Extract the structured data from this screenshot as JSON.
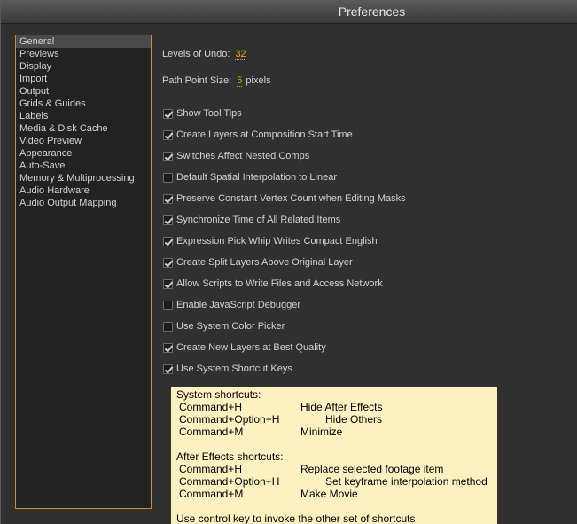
{
  "window": {
    "title": "Preferences"
  },
  "sidebar": {
    "items": [
      {
        "label": "General",
        "selected": true
      },
      {
        "label": "Previews"
      },
      {
        "label": "Display"
      },
      {
        "label": "Import"
      },
      {
        "label": "Output"
      },
      {
        "label": "Grids & Guides"
      },
      {
        "label": "Labels"
      },
      {
        "label": "Media & Disk Cache"
      },
      {
        "label": "Video Preview"
      },
      {
        "label": "Appearance"
      },
      {
        "label": "Auto-Save"
      },
      {
        "label": "Memory & Multiprocessing"
      },
      {
        "label": "Audio Hardware"
      },
      {
        "label": "Audio Output Mapping"
      }
    ]
  },
  "general": {
    "undo_label": "Levels of Undo:",
    "undo_value": "32",
    "path_label": "Path Point Size:",
    "path_value": "5",
    "path_unit": "pixels",
    "options": [
      {
        "label": "Show Tool Tips",
        "checked": true
      },
      {
        "label": "Create Layers at Composition Start Time",
        "checked": true
      },
      {
        "label": "Switches Affect Nested Comps",
        "checked": true
      },
      {
        "label": "Default Spatial Interpolation to Linear",
        "checked": false
      },
      {
        "label": "Preserve Constant Vertex Count when Editing Masks",
        "checked": true
      },
      {
        "label": "Synchronize Time of All Related Items",
        "checked": true
      },
      {
        "label": "Expression Pick Whip Writes Compact English",
        "checked": true
      },
      {
        "label": "Create Split Layers Above Original Layer",
        "checked": true
      },
      {
        "label": "Allow Scripts to Write Files and Access Network",
        "checked": true
      },
      {
        "label": "Enable JavaScript Debugger",
        "checked": false
      },
      {
        "label": "Use System Color Picker",
        "checked": false
      },
      {
        "label": "Create New Layers at Best Quality",
        "checked": true
      },
      {
        "label": "Use System Shortcut Keys",
        "checked": true
      }
    ]
  },
  "tooltip": {
    "system_header": "System shortcuts:",
    "system": [
      {
        "key": "Command+H",
        "action": "Hide After Effects"
      },
      {
        "key": "Command+Option+H",
        "action": "Hide Others"
      },
      {
        "key": "Command+M",
        "action": "Minimize"
      }
    ],
    "ae_header": "After Effects shortcuts:",
    "ae": [
      {
        "key": "Command+H",
        "action": "Replace selected footage item"
      },
      {
        "key": "Command+Option+H",
        "action": "Set keyframe interpolation method"
      },
      {
        "key": "Command+M",
        "action": "Make Movie"
      }
    ],
    "footer": "Use control key to invoke the other set of shortcuts"
  }
}
